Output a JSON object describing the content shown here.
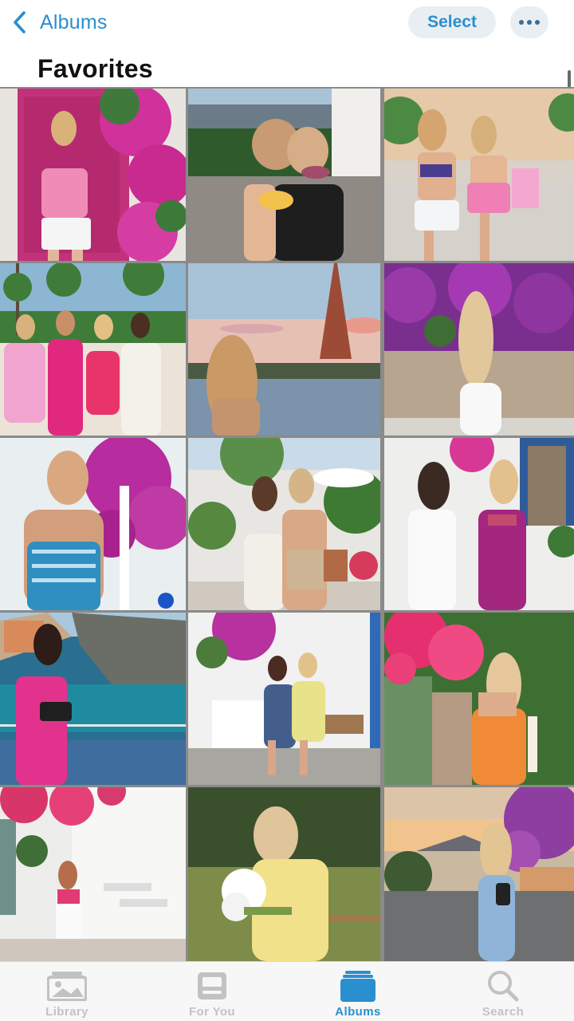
{
  "nav": {
    "back_label": "Albums",
    "select_label": "Select"
  },
  "page_title": "Favorites",
  "photos": [
    "pink-door-bougainvillea",
    "hair-rollers-cocktails",
    "two-friends-bikinis",
    "group-pink-outfits-palms",
    "eiffel-tower-sunset",
    "purple-flowers-stone-wall",
    "blue-dress-bougainvillea",
    "two-friends-hug-plants",
    "two-women-white-pink-dresses",
    "pink-dress-coastal-village",
    "friends-white-bench",
    "orange-dress-pink-flowers",
    "white-house-pink-flowers",
    "yellow-outfit-bouquet",
    "blue-dress-sunset-road"
  ],
  "tabs": [
    {
      "label": "Library",
      "icon": "library-icon",
      "active": false
    },
    {
      "label": "For You",
      "icon": "for-you-icon",
      "active": false
    },
    {
      "label": "Albums",
      "icon": "albums-icon",
      "active": true
    },
    {
      "label": "Search",
      "icon": "search-icon",
      "active": false
    }
  ],
  "colors": {
    "accent": "#2a8fcf",
    "tab_inactive": "#c2c2c2",
    "pill_bg": "#e9eef2"
  }
}
